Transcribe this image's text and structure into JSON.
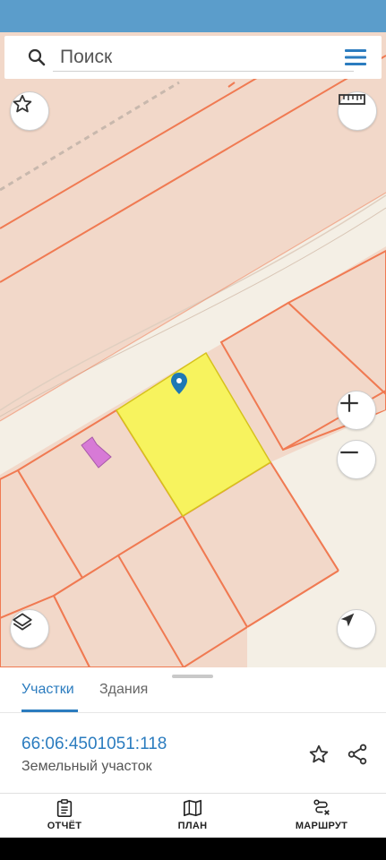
{
  "search": {
    "placeholder": "Поиск"
  },
  "map": {
    "favorite_button": "star-icon",
    "ruler_button": "ruler-icon",
    "zoom_in_button": "plus-icon",
    "zoom_out_button": "minus-icon",
    "layers_button": "layers-icon",
    "locate_button": "navigation-arrow-icon",
    "colors": {
      "background": "#f2d8c9",
      "road": "#f4efe5",
      "parcel_border": "#f07a52",
      "selected_parcel": "#f7f35e",
      "building": "#d77ad6",
      "marker": "#1f78b4"
    }
  },
  "panel": {
    "tabs": [
      {
        "label": "Участки",
        "active": true
      },
      {
        "label": "Здания",
        "active": false
      }
    ],
    "parcel": {
      "cadastral_number": "66:06:4501051:118",
      "type": "Земельный участок"
    }
  },
  "bottom_nav": [
    {
      "label": "ОТЧЁТ",
      "icon": "report-clipboard-icon"
    },
    {
      "label": "ПЛАН",
      "icon": "map-plan-icon"
    },
    {
      "label": "МАРШРУТ",
      "icon": "route-icon"
    }
  ],
  "theme": {
    "status_bar": "#5b9dcb",
    "accent": "#2b7cbf"
  }
}
